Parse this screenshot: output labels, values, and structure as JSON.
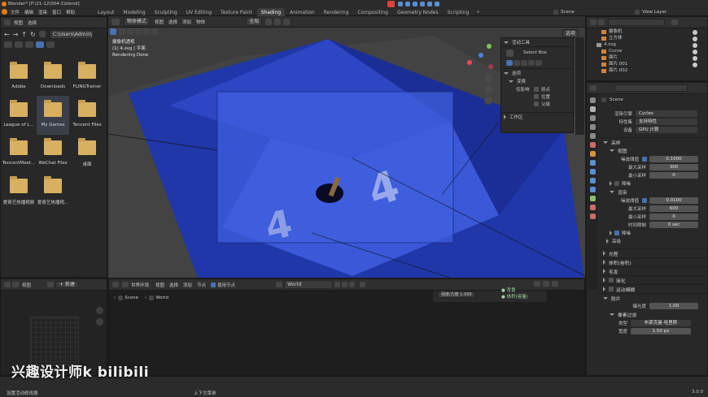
{
  "title_bar": {
    "title": "Blender* [F:\\21-12\\004-1\\blend]"
  },
  "menu": [
    "文件",
    "编辑",
    "渲染",
    "窗口",
    "帮助"
  ],
  "workspaces": [
    "Layout",
    "Modeling",
    "Sculpting",
    "UV Editing",
    "Texture Paint",
    "Shading",
    "Animation",
    "Rendering",
    "Compositing",
    "Geometry Nodes",
    "Scripting"
  ],
  "active_workspace": "Shading",
  "scene_field": "Scene",
  "view_layer_field": "View Layer",
  "file_browser": {
    "menu": [
      "视图",
      "选择"
    ],
    "path": "C:\\Users\\Admin\\",
    "items": [
      {
        "name": "Adobe"
      },
      {
        "name": "Downloads"
      },
      {
        "name": "FLINGTrainer"
      },
      {
        "name": "League of L..."
      },
      {
        "name": "My Games"
      },
      {
        "name": "Tencent Files"
      },
      {
        "name": "TencentMeet..."
      },
      {
        "name": "WeChat Files"
      },
      {
        "name": "桌面"
      },
      {
        "name": "爱奇艺热播视频"
      },
      {
        "name": "爱奇艺热播视..."
      }
    ],
    "selected": "My Games"
  },
  "viewport": {
    "mode": "物体模式",
    "menu": [
      "视图",
      "选择",
      "添加",
      "物体"
    ],
    "transform": "全局",
    "overlay_lines": [
      "摄像机透视",
      "(1) 4.svg | 平面",
      "Rendering Done"
    ],
    "shading_label": "选项",
    "npanel_tool": {
      "header": "活动工具",
      "tool": "Select Box",
      "options_header": "选项",
      "transform_header": "变换",
      "affect_only": "仅影响",
      "checks": [
        "原点",
        "位置",
        "父级"
      ],
      "workspace": "工作区"
    }
  },
  "shader_editor": {
    "header_menu": [
      "视图",
      "选择",
      "添加",
      "节点"
    ],
    "use_nodes": "使用节点",
    "world_type": "世界环境",
    "world_name": "World",
    "breadcrumb": [
      "Scene",
      "World"
    ],
    "node_label": "强度/力度 1.000",
    "legend": [
      "背景",
      "体积(容量)"
    ]
  },
  "image_editor": {
    "menu": [
      "视图"
    ],
    "new_button": "新建"
  },
  "outliner": {
    "items": [
      "摄像机",
      "立方体",
      "4.svg",
      "Curve",
      "面片",
      "面片.001",
      "面片.002"
    ]
  },
  "properties": {
    "search_placeholder": "",
    "breadcrumb": "Scene",
    "render_engine_label": "渲染引擎",
    "render_engine": "Cycles",
    "feature_set_label": "特性集",
    "feature_set": "支持特性",
    "device_label": "设备",
    "device": "GPU 计算",
    "sampling": "采样",
    "viewport": "视图",
    "noise_threshold_label": "噪波阈值",
    "vp_noise_threshold": "0.1000",
    "max_samples_label": "最大采样",
    "vp_max_samples": "300",
    "min_samples_label": "最小采样",
    "vp_min_samples": "0",
    "denoise": "降噪",
    "render": "渲染",
    "r_noise_threshold": "0.0100",
    "r_max_samples": "600",
    "r_min_samples": "0",
    "time_limit_label": "时间限制",
    "r_time_limit": "0 sec",
    "r_denoise": "降噪",
    "advanced": "高级",
    "collapsed": [
      "光程",
      "体积(卷积)",
      "毛发",
      "简化",
      "运动模糊"
    ],
    "film": "胶片",
    "exposure_label": "曝光度",
    "exposure": "1.00",
    "pixel_filter": "像素过滤",
    "filter_type_label": "类型",
    "filter_type": "布莱克曼-哈里斯",
    "filter_width_label": "宽度",
    "filter_width": "1.50 px"
  },
  "status_bar": {
    "left": "设置活动修改器",
    "middle": "上下文菜单",
    "version": "3.0.0"
  },
  "watermark": "兴趣设计师k bilibili"
}
